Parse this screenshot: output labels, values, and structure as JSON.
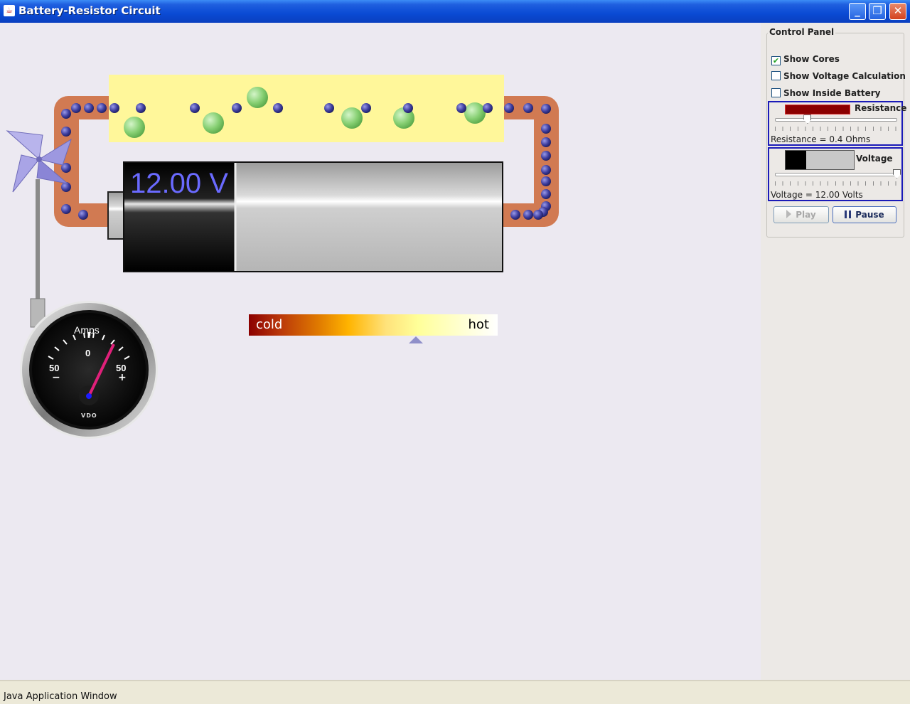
{
  "window": {
    "title": "Battery-Resistor Circuit",
    "minimize": "_",
    "maximize": "❐",
    "close": "✕"
  },
  "battery": {
    "voltage_display": "12.00 V"
  },
  "thermometer": {
    "cold_label": "cold",
    "hot_label": "hot",
    "level": 0.67
  },
  "ammeter": {
    "title": "Amps",
    "left_label": "50",
    "center_label": "0",
    "right_label": "50",
    "left_sign": "−",
    "right_sign": "+",
    "brand": "VDO"
  },
  "control_panel": {
    "title": "Control Panel",
    "checkboxes": [
      {
        "label": "Show Cores",
        "checked": true
      },
      {
        "label": "Show Voltage Calculation",
        "checked": false
      },
      {
        "label": "Show Inside Battery",
        "checked": false
      }
    ],
    "resistance": {
      "label": "Resistance",
      "readout": "Resistance = 0.4 Ohms",
      "slider_fraction": 0.27
    },
    "voltage": {
      "label": "Voltage",
      "readout": "Voltage = 12.00 Volts",
      "slider_fraction": 1.0
    },
    "play_label": "Play",
    "pause_label": "Pause"
  },
  "status_bar": {
    "text": "Java Application Window"
  },
  "colors": {
    "wire": "#d17a52",
    "resistor": "#fff79a",
    "electron": "#4040a8",
    "core": "#7fcf6f",
    "accent": "#1a1ab8"
  }
}
